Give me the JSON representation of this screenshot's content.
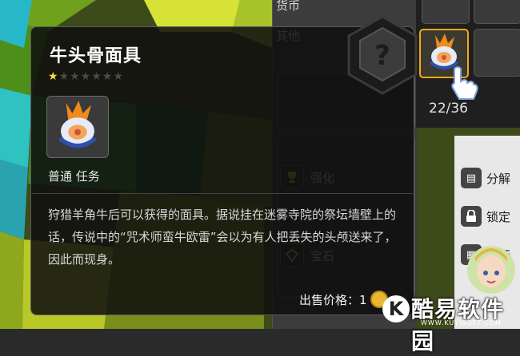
{
  "inventory": {
    "tab_currency": "货币",
    "tab_other": "其他",
    "slot_count": "22/36",
    "actions": [
      {
        "label": "强化",
        "icon": "trophy-icon"
      },
      {
        "label": "宝石",
        "icon": "gem-icon"
      }
    ]
  },
  "right_panel": {
    "buttons": [
      {
        "label": "分解",
        "icon": "disassemble-icon"
      },
      {
        "label": "锁定",
        "icon": "lock-icon"
      },
      {
        "label": "银行",
        "icon": "bank-icon"
      }
    ]
  },
  "tooltip": {
    "name": "牛头骨面具",
    "stars_filled": 1,
    "stars_total": 7,
    "tags": "普通 任务",
    "description": "狩猎羊角牛后可以获得的面具。据说挂在迷雾寺院的祭坛墙壁上的话，传说中的“咒术师蛮牛欧雷”会以为有人把丢失的头颅送来了，因此而现身。",
    "price_label": "出售价格：1",
    "placeholder_glyph": "?"
  },
  "watermark": {
    "badge": "K",
    "text": "酷易软件园",
    "url": "WWW.KUYISOFT.COM"
  },
  "colors": {
    "selected_slot": "#f0a818",
    "star": "#ffd84a",
    "coin": "#e9b830"
  }
}
